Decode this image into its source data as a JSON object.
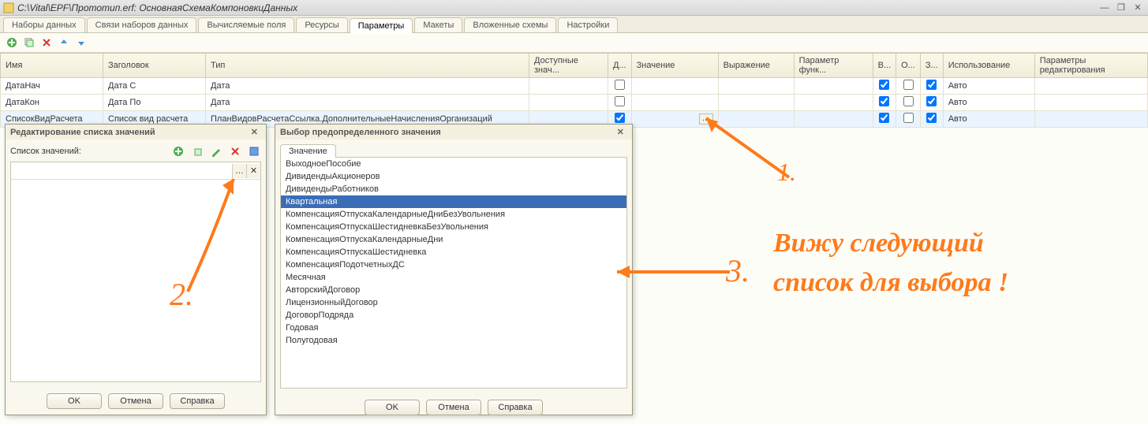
{
  "window": {
    "title": "C:\\Vital\\EPF\\Прототип.erf: ОсновнаяСхемаКомпоновкиДанных"
  },
  "tabs": {
    "items": [
      "Наборы данных",
      "Связи наборов данных",
      "Вычисляемые поля",
      "Ресурсы",
      "Параметры",
      "Макеты",
      "Вложенные схемы",
      "Настройки"
    ],
    "activeIndex": 4
  },
  "grid": {
    "headers": {
      "name": "Имя",
      "title": "Заголовок",
      "type": "Тип",
      "avail": "Доступные знач...",
      "d": "Д...",
      "value": "Значение",
      "expr": "Выражение",
      "paramFunc": "Параметр функ...",
      "v": "В...",
      "o": "О...",
      "z": "З...",
      "usage": "Использование",
      "editParams": "Параметры редактирования"
    },
    "rows": [
      {
        "name": "ДатаНач",
        "title": "Дата С",
        "type": "Дата",
        "avail": "",
        "d": false,
        "value": "",
        "expr": "",
        "paramFunc": "",
        "v": true,
        "o": false,
        "z": true,
        "usage": "Авто",
        "editParams": ""
      },
      {
        "name": "ДатаКон",
        "title": "Дата По",
        "type": "Дата",
        "avail": "",
        "d": false,
        "value": "",
        "expr": "",
        "paramFunc": "",
        "v": true,
        "o": false,
        "z": true,
        "usage": "Авто",
        "editParams": ""
      },
      {
        "name": "СписокВидРасчета",
        "title": "Список вид расчета",
        "type": "ПланВидовРасчетаСсылка.ДополнительныеНачисленияОрганизаций",
        "avail": "",
        "d": true,
        "value": "",
        "expr": "",
        "paramFunc": "",
        "v": true,
        "o": false,
        "z": true,
        "usage": "Авто",
        "editParams": ""
      }
    ]
  },
  "dialog1": {
    "title": "Редактирование списка значений",
    "label": "Список значений:",
    "ok": "OK",
    "cancel": "Отмена",
    "help": "Справка"
  },
  "dialog2": {
    "title": "Выбор предопределенного значения",
    "tab": "Значение",
    "items": [
      "ВыходноеПособие",
      "ДивидендыАкционеров",
      "ДивидендыРаботников",
      "Квартальная",
      "КомпенсацияОтпускаКалендарныеДниБезУвольнения",
      "КомпенсацияОтпускаШестидневкаБезУвольнения",
      "КомпенсацияОтпускаКалендарныеДни",
      "КомпенсацияОтпускаШестидневка",
      "КомпенсацияПодотчетныхДС",
      "Месячная",
      "АвторскийДоговор",
      "ЛицензионныйДоговор",
      "ДоговорПодряда",
      "Годовая",
      "Полугодовая"
    ],
    "selectedIndex": 3,
    "ok": "OK",
    "cancel": "Отмена",
    "help": "Справка"
  },
  "annotations": {
    "a1": "1.",
    "a2": "2.",
    "a3": "3.",
    "text1": "Вижу следующий",
    "text2": "список для выбора !"
  }
}
